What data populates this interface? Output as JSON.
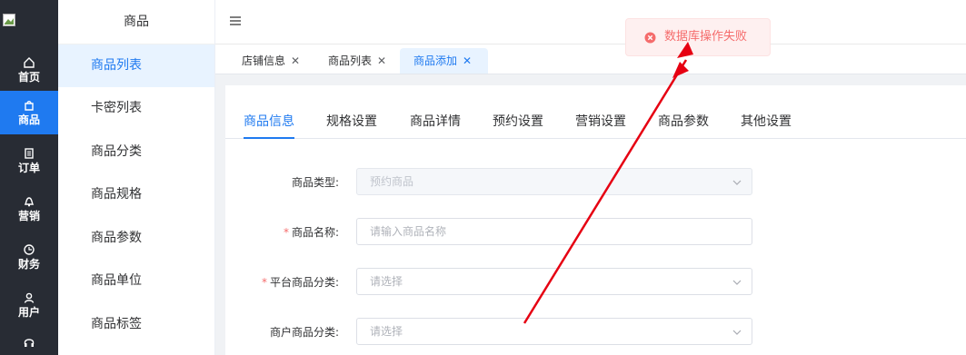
{
  "rail": {
    "items": [
      {
        "label": "首页",
        "icon": "home-icon"
      },
      {
        "label": "商品",
        "icon": "shop-bag-icon"
      },
      {
        "label": "订单",
        "icon": "document-icon"
      },
      {
        "label": "营销",
        "icon": "bell-icon"
      },
      {
        "label": "财务",
        "icon": "clock-icon"
      },
      {
        "label": "用户",
        "icon": "user-icon"
      },
      {
        "label": "",
        "icon": "headset-icon"
      }
    ]
  },
  "submenu": {
    "title": "商品",
    "items": [
      "商品列表",
      "卡密列表",
      "商品分类",
      "商品规格",
      "商品参数",
      "商品单位",
      "商品标签"
    ]
  },
  "tabs": [
    {
      "label": "店铺信息"
    },
    {
      "label": "商品列表"
    },
    {
      "label": "商品添加"
    }
  ],
  "inner_tabs": [
    "商品信息",
    "规格设置",
    "商品详情",
    "预约设置",
    "营销设置",
    "商品参数",
    "其他设置"
  ],
  "form": {
    "type": {
      "label": "商品类型:",
      "value": "预约商品"
    },
    "name": {
      "label": "商品名称:",
      "placeholder": "请输入商品名称"
    },
    "platform_category": {
      "label": "平台商品分类:",
      "placeholder": "请选择"
    },
    "merchant_category": {
      "label": "商户商品分类:",
      "placeholder": "请选择"
    }
  },
  "toast": {
    "message": "数据库操作失败",
    "icon": "error-circle-icon"
  },
  "colors": {
    "accent": "#1f7af0",
    "rail_bg": "#282c34",
    "error": "#f56c6c",
    "annotation": "#e60012"
  }
}
